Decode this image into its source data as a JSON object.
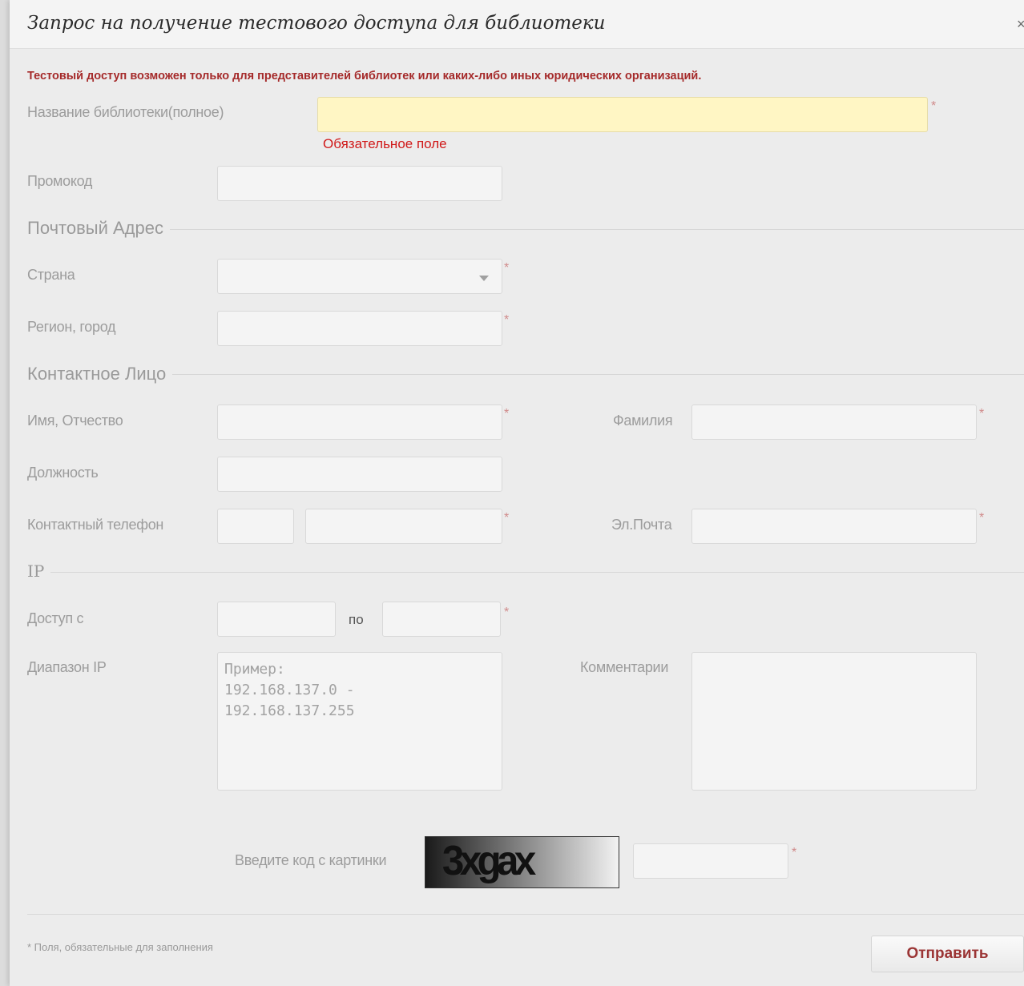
{
  "dialog": {
    "title": "Запрос на получение тестового доступа для библиотеки",
    "close": "×"
  },
  "notice": "Тестовый доступ возможен только для представителей библиотек или каких-либо иных юридических организаций.",
  "fields": {
    "library_name": {
      "label": "Название библиотеки(полное)",
      "value": "",
      "error": "Обязательное поле"
    },
    "promo": {
      "label": "Промокод",
      "value": ""
    },
    "country": {
      "label": "Страна",
      "selected": ""
    },
    "region": {
      "label": "Регион, город",
      "value": ""
    },
    "first_name": {
      "label": "Имя, Отчество",
      "value": ""
    },
    "last_name": {
      "label": "Фамилия",
      "value": ""
    },
    "position": {
      "label": "Должность",
      "value": ""
    },
    "phone": {
      "label": "Контактный телефон",
      "code": "",
      "number": ""
    },
    "email": {
      "label": "Эл.Почта",
      "value": ""
    },
    "access": {
      "label": "Доступ с",
      "to_label": "по",
      "from": "",
      "to": ""
    },
    "ip_range": {
      "label": "Диапазон IP",
      "placeholder": "Пример:\n192.168.137.0 -\n192.168.137.255"
    },
    "comments": {
      "label": "Комментарии",
      "value": ""
    },
    "captcha": {
      "label": "Введите код с картинки",
      "image_text": "3xgax",
      "value": ""
    }
  },
  "sections": {
    "postal": "Почтовый Адрес",
    "contact": "Контактное Лицо",
    "ip": "IP"
  },
  "required_mark": "*",
  "footer": {
    "note": "* Поля, обязательные для заполнения",
    "submit_label": "Отправить"
  },
  "colors": {
    "accent": "#a52a2a",
    "error": "#d01818",
    "required_field_bg": "#fff6c4"
  }
}
